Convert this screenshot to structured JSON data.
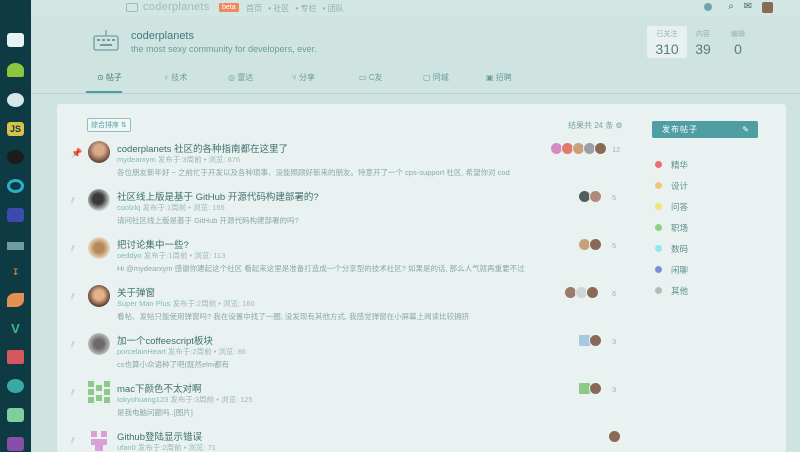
{
  "topbar": {
    "brand": "coderplanets",
    "beta": "beta",
    "nav": [
      "首页",
      "• 社区",
      "• 专栏",
      "• 团队"
    ]
  },
  "community": {
    "title": "coderplanets",
    "desc": "the most sexy community for developers, ever.",
    "stats": [
      {
        "label": "已关注",
        "value": "310"
      },
      {
        "label": "内容",
        "value": "39"
      },
      {
        "label": "编辑",
        "value": "0"
      }
    ],
    "tabs": [
      "帖子",
      "技术",
      "雷达",
      "分享",
      "C友",
      "同城",
      "招聘"
    ]
  },
  "list": {
    "sort_label": "综合排序",
    "result_text": "结果共 24 条",
    "posts": [
      {
        "title": "coderplanets 社区的各种指南都在这里了",
        "author": "mydearxym",
        "info": "发布于:3周前 • 浏览: 676",
        "digest": "各位朋友新年好 ~ 之前忙于开发以及各种琐事、没能照顾好新来的朋友。特意开了一个 cps-support 社区, 希望你对 cod",
        "count": "12",
        "pinned": true
      },
      {
        "title": "社区线上版是基于 GitHub 开源代码构建部署的?",
        "author": "coolzlq",
        "info": "发布于:1周前 • 浏览: 165",
        "digest": "请问社区线上版是基于 GitHub 开源代码构建部署的吗?",
        "count": "5",
        "pinned": false
      },
      {
        "title": "把讨论集中一些?",
        "author": "oeddyo",
        "info": "发布于:1周前 • 浏览: 113",
        "digest": "Hi @mydearxym 感谢你建起这个社区 看起来这里是准备打造成一个分享型的技术社区? 如果是的话, 那么人气就再重要不过",
        "count": "5",
        "pinned": false
      },
      {
        "title": "关于弹窗",
        "author": "Super Man Plus",
        "info": "发布于:2周前 • 浏览: 160",
        "digest": "看帖、发帖只能使用弹窗吗? 我在设置中找了一圈, 没发现有其他方式, 我感觉弹窗在小屏幕上阅读比较拥挤",
        "count": "6",
        "pinned": false
      },
      {
        "title": "加一个coffeescript板块",
        "author": "porcelainHeart",
        "info": "发布于:2周前 • 浏览: 86",
        "digest": "cs也算小众语种了吧(既然elm都有",
        "count": "3",
        "pinned": false
      },
      {
        "title": "mac下颜色不太对啊",
        "author": "tokyohuang123",
        "info": "发布于:3周前 • 浏览: 125",
        "digest": "是我电脑问题吗..[图片]",
        "count": "3",
        "pinned": false
      },
      {
        "title": "Github登陆显示错误",
        "author": "ufan0",
        "info": "发布于:2周前 • 浏览: 71",
        "digest": "",
        "count": "",
        "pinned": false
      }
    ]
  },
  "sidebar": {
    "publish_label": "发布帖子",
    "tags": [
      {
        "label": "精华",
        "color": "#f06b72"
      },
      {
        "label": "设计",
        "color": "#f2c47a"
      },
      {
        "label": "问答",
        "color": "#f6e27a"
      },
      {
        "label": "职场",
        "color": "#8fd082"
      },
      {
        "label": "数码",
        "color": "#8de9f0"
      },
      {
        "label": "闲聊",
        "color": "#7f8be0"
      },
      {
        "label": "其他",
        "color": "#b9b9b9"
      }
    ]
  }
}
